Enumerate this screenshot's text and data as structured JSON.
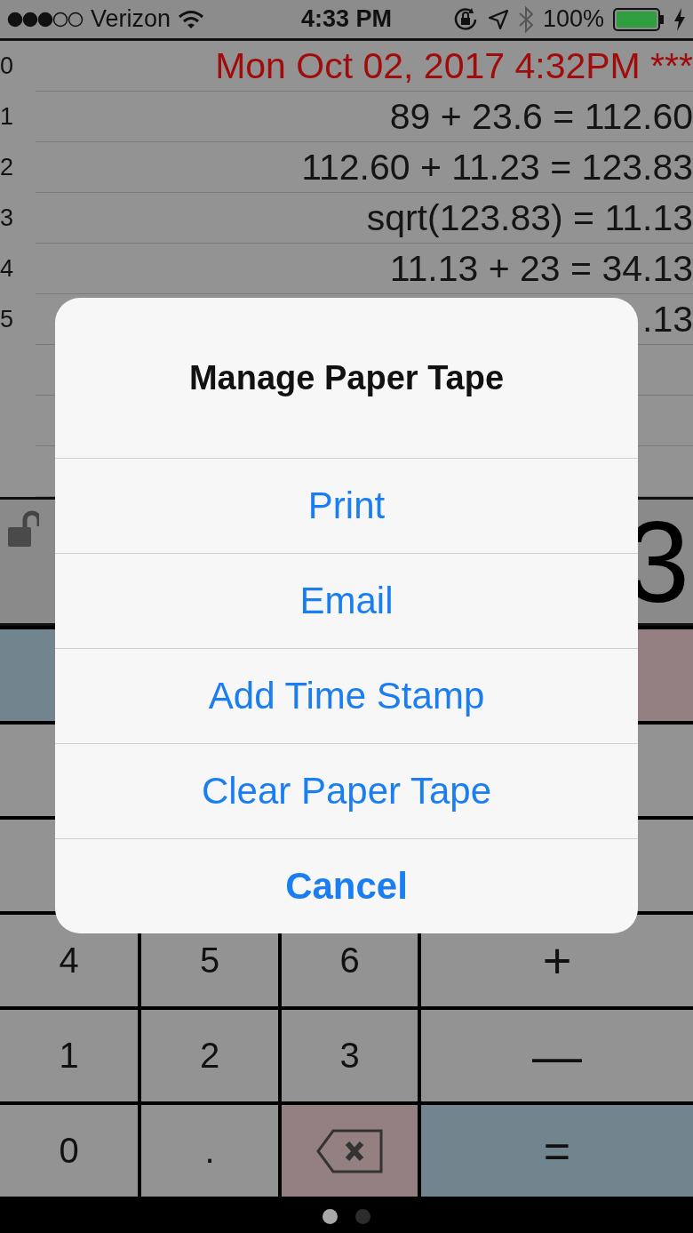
{
  "status_bar": {
    "carrier": "Verizon",
    "time": "4:33 PM",
    "battery": "100%"
  },
  "tape": {
    "rows": [
      {
        "number": "0",
        "text": "Mon Oct 02, 2017 4:32PM ***",
        "kind": "timestamp"
      },
      {
        "number": "1",
        "text": "89 + 23.6 = 112.60",
        "kind": "entry"
      },
      {
        "number": "2",
        "text": "112.60 + 11.23 = 123.83",
        "kind": "entry"
      },
      {
        "number": "3",
        "text": "sqrt(123.83) = 11.13",
        "kind": "entry"
      },
      {
        "number": "4",
        "text": "11.13 + 23 = 34.13",
        "kind": "entry"
      },
      {
        "number": "5",
        "text": ".13",
        "kind": "entry"
      },
      {
        "kind": "empty"
      },
      {
        "kind": "empty"
      },
      {
        "kind": "empty"
      }
    ]
  },
  "display": {
    "value": "3",
    "locked": false
  },
  "keypad": {
    "rows": [
      [
        {
          "kind": "memory"
        },
        {
          "kind": "hidden"
        },
        {
          "kind": "hidden"
        },
        {
          "kind": "clear"
        }
      ],
      [
        {
          "kind": "digit"
        },
        {
          "kind": "hidden"
        },
        {
          "kind": "hidden"
        },
        {
          "kind": "digit"
        }
      ],
      [
        {
          "kind": "digit"
        },
        {
          "kind": "hidden"
        },
        {
          "kind": "hidden"
        },
        {
          "kind": "digit"
        }
      ],
      [
        {
          "kind": "digit",
          "label": "4"
        },
        {
          "kind": "digit",
          "label": "5"
        },
        {
          "kind": "digit",
          "label": "6"
        },
        {
          "kind": "operator",
          "label": "+"
        }
      ],
      [
        {
          "kind": "digit",
          "label": "1"
        },
        {
          "kind": "digit",
          "label": "2"
        },
        {
          "kind": "digit",
          "label": "3"
        },
        {
          "kind": "operator",
          "label": "—"
        }
      ],
      [
        {
          "kind": "digit",
          "label": "0"
        },
        {
          "kind": "digit",
          "label": "."
        },
        {
          "kind": "delete"
        },
        {
          "kind": "equals",
          "label": "="
        }
      ]
    ]
  },
  "pages": [
    {
      "selected": true
    },
    {
      "selected": false
    }
  ],
  "dialog": {
    "title": "Manage Paper Tape",
    "actions": [
      {
        "label": "Print",
        "kind": "default"
      },
      {
        "label": "Email",
        "kind": "default"
      },
      {
        "label": "Add Time Stamp",
        "kind": "default"
      },
      {
        "label": "Clear Paper Tape",
        "kind": "default"
      },
      {
        "label": "Cancel",
        "kind": "cancel"
      }
    ]
  }
}
